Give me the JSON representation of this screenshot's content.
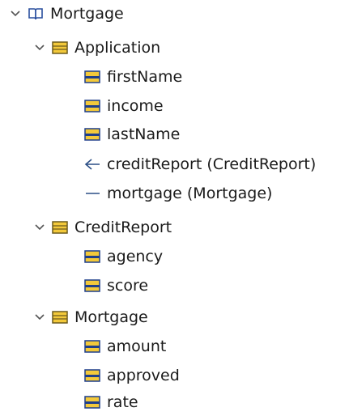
{
  "colors": {
    "class_fill": "#f3c93a",
    "class_border": "#6b5a1c",
    "attr_fill": "#f3c93a",
    "attr_border": "#1f3f8a",
    "package_border": "#2a4f9e",
    "chevron": "#555555",
    "relation": "#2c4f86"
  },
  "tree": {
    "root": {
      "label": "Mortgage",
      "icon": "package-icon",
      "expanded": true
    },
    "application": {
      "label": "Application",
      "icon": "class-icon",
      "expanded": true,
      "children": [
        {
          "label": "firstName",
          "icon": "attribute-icon"
        },
        {
          "label": "income",
          "icon": "attribute-icon"
        },
        {
          "label": "lastName",
          "icon": "attribute-icon"
        },
        {
          "label": "creditReport (CreditReport)",
          "icon": "association-many-icon"
        },
        {
          "label": "mortgage (Mortgage)",
          "icon": "association-one-icon"
        }
      ]
    },
    "creditreport": {
      "label": "CreditReport",
      "icon": "class-icon",
      "expanded": true,
      "children": [
        {
          "label": "agency",
          "icon": "attribute-icon"
        },
        {
          "label": "score",
          "icon": "attribute-icon"
        }
      ]
    },
    "mortgage": {
      "label": "Mortgage",
      "icon": "class-icon",
      "expanded": true,
      "children": [
        {
          "label": "amount",
          "icon": "attribute-icon"
        },
        {
          "label": "approved",
          "icon": "attribute-icon"
        },
        {
          "label": "rate",
          "icon": "attribute-icon"
        }
      ]
    }
  }
}
